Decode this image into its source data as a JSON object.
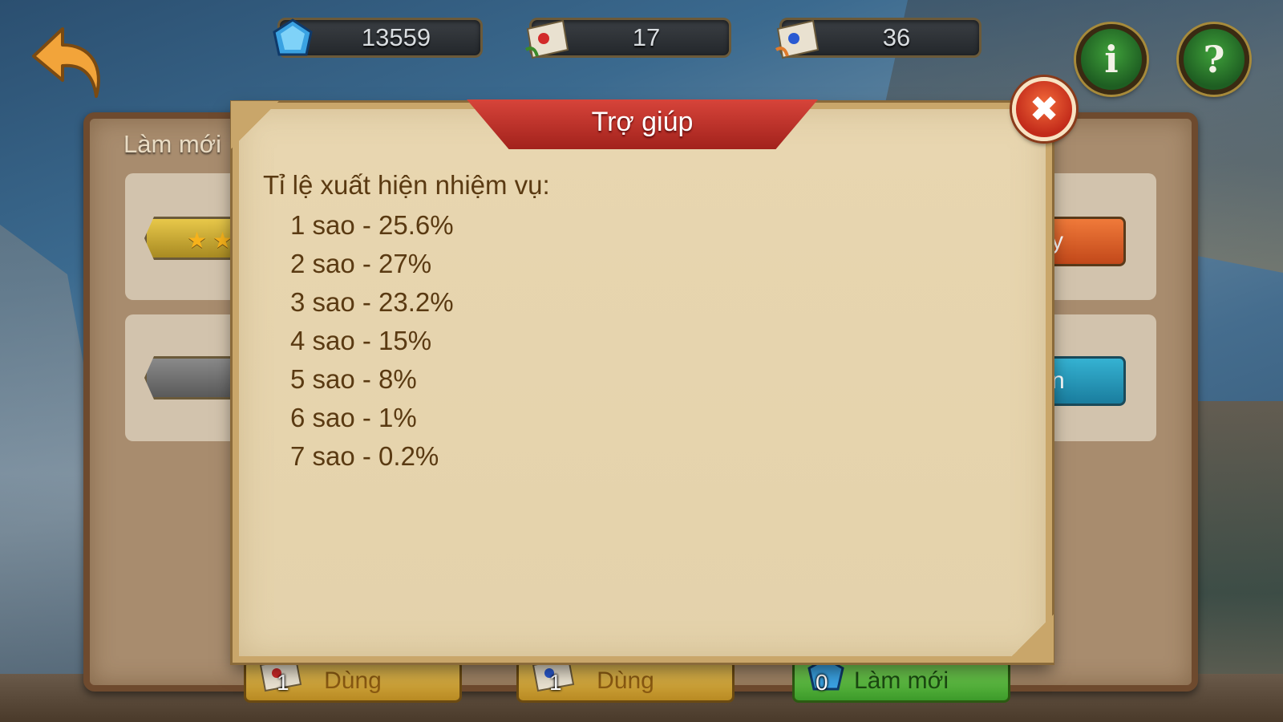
{
  "resources": {
    "gems": "13559",
    "scroll_red": "17",
    "scroll_blue": "36"
  },
  "buttons": {
    "info_label": "i",
    "help_label": "?",
    "close_label": "✖"
  },
  "background_panel": {
    "title_partial": "Làm mới",
    "slot1_button_partial": "y",
    "slot2_button_partial": "n"
  },
  "bottom_bar": [
    {
      "label": "Dùng",
      "count": "1"
    },
    {
      "label": "Dùng",
      "count": "1"
    },
    {
      "label": "Làm mới",
      "count": "0"
    }
  ],
  "dialog": {
    "title": "Trợ giúp",
    "heading": "Tỉ lệ xuất hiện nhiệm vụ:",
    "rates": [
      "1 sao - 25.6%",
      "2 sao - 27%",
      "3 sao - 23.2%",
      "4 sao - 15%",
      "5 sao - 8%",
      "6 sao - 1%",
      "7 sao - 0.2%"
    ]
  }
}
